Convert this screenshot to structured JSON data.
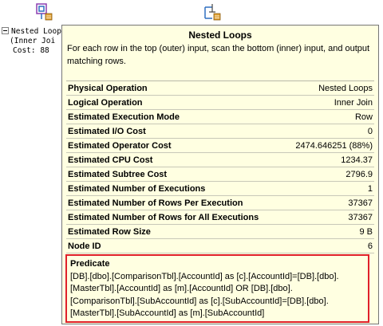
{
  "background": {
    "node_lines": [
      "Nested Loop",
      "(Inner Joi",
      "Cost: 88 "
    ]
  },
  "tooltip": {
    "title": "Nested Loops",
    "description": "For each row in the top (outer) input, scan the bottom (inner) input, and output matching rows.",
    "properties": [
      {
        "key": "Physical Operation",
        "value": "Nested Loops"
      },
      {
        "key": "Logical Operation",
        "value": "Inner Join"
      },
      {
        "key": "Estimated Execution Mode",
        "value": "Row"
      },
      {
        "key": "Estimated I/O Cost",
        "value": "0"
      },
      {
        "key": "Estimated Operator Cost",
        "value": "2474.646251 (88%)"
      },
      {
        "key": "Estimated CPU Cost",
        "value": "1234.37"
      },
      {
        "key": "Estimated Subtree Cost",
        "value": "2796.9"
      },
      {
        "key": "Estimated Number of Executions",
        "value": "1"
      },
      {
        "key": "Estimated Number of Rows Per Execution",
        "value": "37367"
      },
      {
        "key": "Estimated Number of Rows for All Executions",
        "value": "37367"
      },
      {
        "key": "Estimated Row Size",
        "value": "9 B"
      },
      {
        "key": "Node ID",
        "value": "6"
      }
    ],
    "predicate": {
      "title": "Predicate",
      "lines": [
        "[DB].[dbo].[ComparisonTbl].[AccountId] as [c].[AccountId]=[DB].[dbo].",
        "[MasterTbl].[AccountId] as [m].[AccountId] OR [DB].[dbo].",
        "[ComparisonTbl].[SubAccountId] as [c].[SubAccountId]=[DB].[dbo].",
        "[MasterTbl].[SubAccountId] as [m].[SubAccountId]"
      ]
    }
  },
  "colors": {
    "tooltip_bg": "#ffffe1",
    "highlight_border": "#e0202a",
    "icon_blue": "#2f6fc0",
    "icon_purple": "#8b3fb0",
    "icon_orange": "#e0a030"
  },
  "icons": [
    "nested-loops-icon",
    "nested-loops-icon"
  ]
}
